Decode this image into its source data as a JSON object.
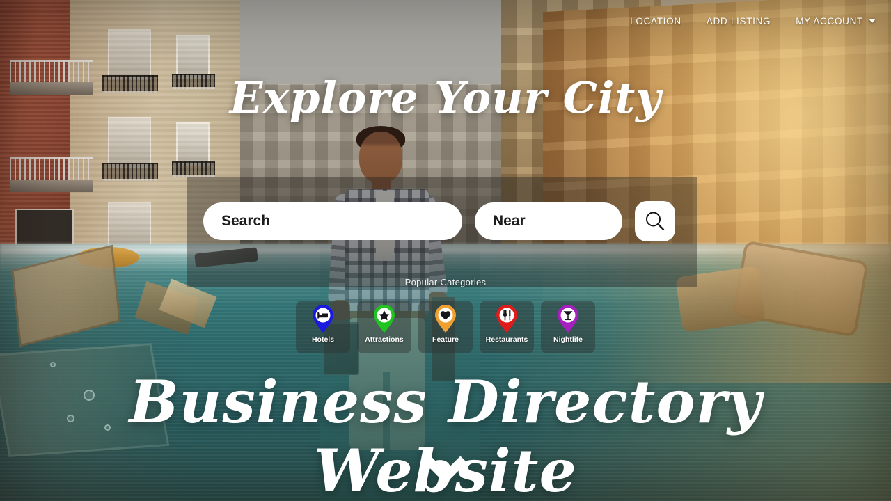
{
  "page": {
    "hero_title_top": "Explore Your City",
    "hero_title_bottom": "Business Directory Website"
  },
  "nav": {
    "items": [
      {
        "label": "LOCATION",
        "icon": ""
      },
      {
        "label": "ADD LISTING",
        "icon": ""
      },
      {
        "label": "MY ACCOUNT",
        "icon": "chevron-down-icon"
      }
    ]
  },
  "search": {
    "query_value": "",
    "query_placeholder": "Search",
    "near_value": "",
    "near_placeholder": "Near",
    "button_icon": "search-icon"
  },
  "categories": {
    "title": "Popular Categories",
    "items": [
      {
        "label": "Hotels",
        "icon": "bed-icon",
        "color": "#1a1ae0"
      },
      {
        "label": "Attractions",
        "icon": "star-icon",
        "color": "#1fc41f"
      },
      {
        "label": "Feature",
        "icon": "heart-icon",
        "color": "#f0a030"
      },
      {
        "label": "Restaurants",
        "icon": "cutlery-icon",
        "color": "#e01b1b"
      },
      {
        "label": "Nightlife",
        "icon": "cocktail-icon",
        "color": "#a81fc0"
      }
    ]
  },
  "footer": {
    "scroll_icon": "chevron-down-icon"
  },
  "colors": {
    "text_light": "#ffffff",
    "panel_overlay": "rgba(38,36,34,0.42)",
    "tile_overlay": "rgba(46,50,48,0.45)"
  }
}
